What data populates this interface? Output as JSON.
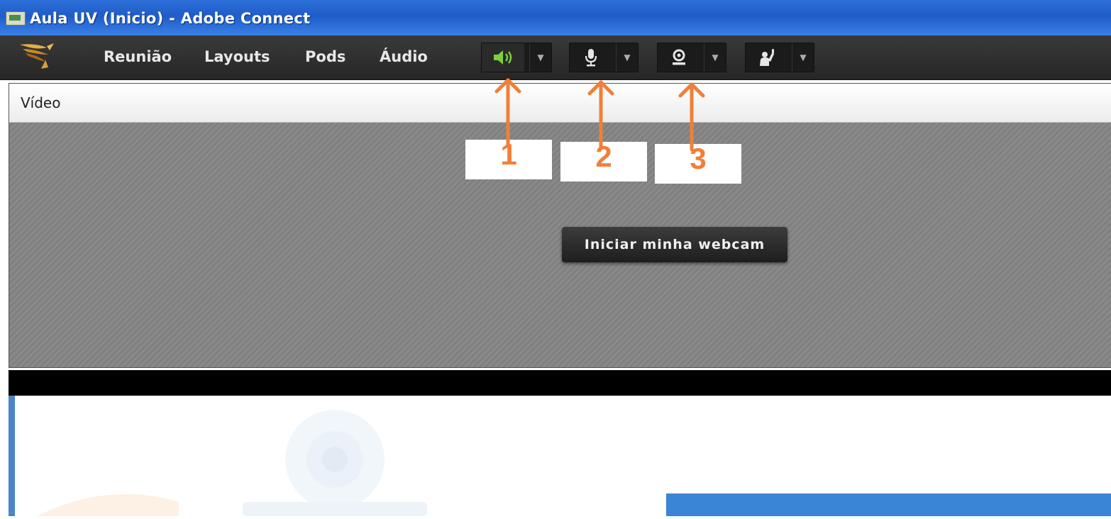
{
  "window": {
    "title": "Aula UV (Inicio) - Adobe Connect"
  },
  "menu": {
    "items": [
      "Reunião",
      "Layouts",
      "Pods",
      "Áudio"
    ]
  },
  "toolbar": {
    "speaker": {
      "icon": "speaker-icon",
      "state": "on",
      "color": "#7cd03c"
    },
    "microphone": {
      "icon": "microphone-icon"
    },
    "camera": {
      "icon": "webcam-icon"
    },
    "raise_hand": {
      "icon": "raise-hand-icon"
    }
  },
  "video_pod": {
    "title": "Vídeo",
    "webcam_button": "Iniciar minha webcam"
  },
  "annotations": {
    "color": "#f07f3a",
    "labels": [
      "1",
      "2",
      "3"
    ]
  }
}
